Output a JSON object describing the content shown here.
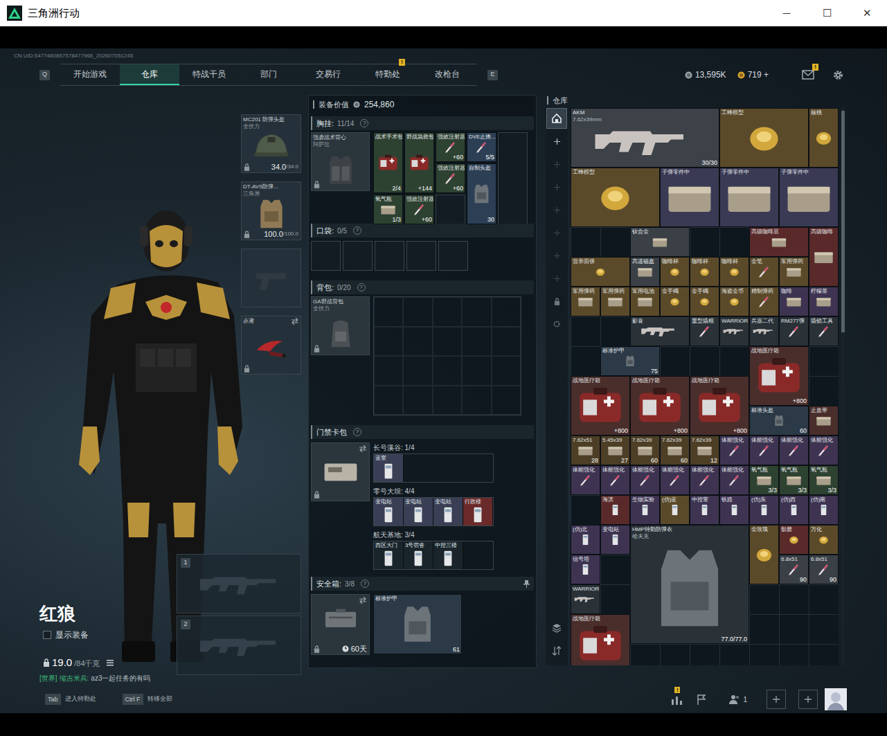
{
  "window": {
    "title": "三角洲行动",
    "controls": [
      "─",
      "☐",
      "✕"
    ]
  },
  "uid": "CN UID:5477460857578477966_202607051245",
  "nav": {
    "prev_key": "Q",
    "next_key": "E",
    "tabs": [
      {
        "label": "开始游戏",
        "selected": false
      },
      {
        "label": "仓库",
        "selected": true
      },
      {
        "label": "特战干员",
        "selected": false
      },
      {
        "label": "部门",
        "selected": false
      },
      {
        "label": "交易行",
        "selected": false
      },
      {
        "label": "特勤处",
        "selected": false,
        "badge": "!"
      },
      {
        "label": "改枪台",
        "selected": false
      }
    ]
  },
  "currency": {
    "coins": "13,595K",
    "bonds": "719 +"
  },
  "mail": {
    "badge": "!"
  },
  "character": {
    "name": "红狼",
    "show_equipment": {
      "label": "显示装备",
      "checked": false
    },
    "weight": "19.0",
    "weight_limit": "/84千克"
  },
  "chat": {
    "channel": "[世界]",
    "sender": "缩吉米兵:",
    "message": "az3一起任务的有吗"
  },
  "equipment_slots": [
    {
      "kind": "helmet",
      "name": "MC201 防弹头盔",
      "sub": "全技力",
      "value": "34.0",
      "max": "/34.0",
      "locked": true
    },
    {
      "kind": "armor",
      "name": "DT-AVS防弹...",
      "sub": "三角洲",
      "value": "100.0",
      "max": "/100.0",
      "locked": true
    },
    {
      "kind": "pistol",
      "locked": false
    },
    {
      "kind": "melee",
      "name": "赤鸢",
      "locked": true
    }
  ],
  "weapon_slots": [
    {
      "number": "1"
    },
    {
      "number": "2"
    }
  ],
  "loadout": {
    "value_label": "装备价值",
    "value": "254,860",
    "chest_rig": {
      "label": "胸挂:",
      "capacity": "11/14",
      "help": "?",
      "item": {
        "name": "强袭战术背心",
        "sub": "阿萨拉",
        "locked": true
      },
      "slots": [
        {
          "name": "战术手术包",
          "count": "2/4",
          "color": "#2e4232"
        },
        {
          "name": "野战急救包",
          "count": "+144",
          "color": "#2e4232"
        },
        {
          "name": "强效注射器",
          "count": "+60",
          "color": "#2e4232"
        },
        {
          "name": "DVE止痛...",
          "count": "5/5",
          "color": "#2c3f55"
        },
        {
          "name": "强效注射器",
          "count": "+60",
          "color": "#2e4232"
        },
        {
          "name": "自制头盔",
          "count": "30",
          "color": "#2c3f55"
        },
        {
          "name": "氧气瓶",
          "count": "1/3",
          "color": "#2e4232"
        },
        {
          "name": "强效注射器",
          "count": "+60",
          "color": "#2e4232"
        }
      ]
    },
    "pockets": {
      "label": "口袋:",
      "capacity": "0/5",
      "help": "?"
    },
    "backpack": {
      "label": "背包:",
      "capacity": "0/20",
      "help": "?",
      "item": {
        "name": "GA野战背包",
        "sub": "全技力",
        "locked": true
      }
    },
    "keycard_case": {
      "label": "门禁卡包",
      "help": "?",
      "locked": true,
      "maps": [
        {
          "label": "长号溪谷: 1/4",
          "cards": [
            {
              "name": "蓝室",
              "color": "#3a3f55"
            }
          ]
        },
        {
          "label": "零号大坝: 4/4",
          "cards": [
            {
              "name": "变电站",
              "color": "#3a3f55"
            },
            {
              "name": "变电站",
              "color": "#3a3f55"
            },
            {
              "name": "变电站",
              "color": "#3a3f55"
            },
            {
              "name": "行政楼",
              "color": "#6a2a2a"
            }
          ]
        },
        {
          "label": "航天基地: 3/4",
          "cards": [
            {
              "name": "西区大门",
              "color": "#1a242b"
            },
            {
              "name": "3号宿舍",
              "color": "#1a242b"
            },
            {
              "name": "中控三楼",
              "color": "#1a242b"
            }
          ]
        }
      ]
    },
    "safe_box": {
      "label": "安全箱:",
      "capacity": "3/8",
      "help": "?",
      "timer": "60天",
      "locked": true,
      "items": [
        {
          "name": "标准护甲",
          "count": "61",
          "color": "#2c3a48"
        }
      ]
    }
  },
  "warehouse": {
    "title": "仓库",
    "side_tabs": [
      {
        "selected": true,
        "disabled": false
      },
      {
        "selected": false,
        "disabled": false
      },
      {
        "selected": false,
        "disabled": true
      },
      {
        "selected": false,
        "disabled": true
      },
      {
        "selected": false,
        "disabled": true
      },
      {
        "selected": false,
        "disabled": true
      },
      {
        "selected": false,
        "disabled": true
      },
      {
        "selected": false,
        "disabled": true
      },
      {
        "selected": false,
        "disabled": false
      },
      {
        "selected": false,
        "disabled": false
      }
    ],
    "items": [
      {
        "name": "AKM",
        "sub": "7.62x39mm",
        "count": "30/30",
        "color": "#3c4248"
      },
      {
        "name": "工蜂模型",
        "color": "#5b4a2a"
      },
      {
        "name": "核桃",
        "color": "#5b4a2a"
      },
      {
        "name": "工蜂模型",
        "color": "#5b4a2a"
      },
      {
        "name": "子弹零件中",
        "color": "#3a3a55"
      },
      {
        "name": "子弹零件中",
        "color": "#3a3a55"
      },
      {
        "name": "子弹零件中",
        "color": "#3a3a55"
      },
      {
        "name": "钛合金",
        "color": "#3a4046"
      },
      {
        "name": "高级咖啡豆",
        "color": "#5a2a2a"
      },
      {
        "name": "高级咖啡",
        "color": "#5a2a2a"
      },
      {
        "name": "营养面饼",
        "color": "#5b4a2a"
      },
      {
        "name": "高速磁盘",
        "color": "#3a4046"
      },
      {
        "name": "咖啡杯",
        "color": "#5b4a2a"
      },
      {
        "name": "咖啡杯",
        "color": "#5b4a2a"
      },
      {
        "name": "咖啡杯",
        "color": "#5b4a2a"
      },
      {
        "name": "金笔",
        "color": "#5b4a2a"
      },
      {
        "name": "军用弹药",
        "color": "#5b4a2a"
      },
      {
        "name": "军用弹药",
        "color": "#5b4a2a"
      },
      {
        "name": "军用弹药",
        "color": "#5b4a2a"
      },
      {
        "name": "军用电池",
        "color": "#5b4a2a"
      },
      {
        "name": "金手镯",
        "color": "#5b4a2a"
      },
      {
        "name": "金手镯",
        "color": "#5b4a2a"
      },
      {
        "name": "海盗金币",
        "color": "#5b4a2a"
      },
      {
        "name": "精制弹药",
        "color": "#5b4a2a"
      },
      {
        "name": "咖啡",
        "color": "#3e3452"
      },
      {
        "name": "柠檬茶",
        "color": "#3e3452"
      },
      {
        "name": "影青",
        "color": "#2a3238"
      },
      {
        "name": "重型撬棍",
        "color": "#2a3238"
      },
      {
        "name": "WARRIOR",
        "color": "#2a3238"
      },
      {
        "name": "兵器二代",
        "color": "#2a3238"
      },
      {
        "name": "RM277弹",
        "color": "#2a3238"
      },
      {
        "name": "撬锁工具",
        "color": "#2a3238"
      },
      {
        "name": "标准护甲",
        "count": "75",
        "color": "#2c3a48"
      },
      {
        "name": "战地医疗箱",
        "count": "+800",
        "color": "#4a2e2c"
      },
      {
        "name": "战地医疗箱",
        "count": "+800",
        "color": "#4a2e2c"
      },
      {
        "name": "战地医疗箱",
        "count": "+800",
        "color": "#4a2e2c"
      },
      {
        "name": "战地医疗箱",
        "count": "+800",
        "color": "#4a2e2c"
      },
      {
        "name": "标准头盔",
        "count": "60",
        "color": "#2c3a48"
      },
      {
        "name": "止血带",
        "color": "#4a2e2c"
      },
      {
        "name": "7.62x51",
        "count": "28",
        "color": "#4d3e26"
      },
      {
        "name": "5.45x39",
        "count": "27",
        "color": "#4d3e26"
      },
      {
        "name": "7.62x39",
        "count": "60",
        "color": "#4d3e26"
      },
      {
        "name": "7.62x39",
        "count": "60",
        "color": "#4d3e26"
      },
      {
        "name": "7.62x39",
        "count": "12",
        "color": "#4d3e26"
      },
      {
        "name": "体能强化",
        "color": "#3e3452"
      },
      {
        "name": "体能强化",
        "color": "#3e3452"
      },
      {
        "name": "体能强化",
        "color": "#3e3452"
      },
      {
        "name": "体能强化",
        "color": "#3e3452"
      },
      {
        "name": "体能强化",
        "color": "#3e3452"
      },
      {
        "name": "体能强化",
        "color": "#3e3452"
      },
      {
        "name": "体能强化",
        "color": "#3e3452"
      },
      {
        "name": "体能强化",
        "color": "#3e3452"
      },
      {
        "name": "体能强化",
        "color": "#3e3452"
      },
      {
        "name": "体能强化",
        "color": "#3e3452"
      },
      {
        "name": "氧气瓶",
        "count": "3/3",
        "color": "#2e4232"
      },
      {
        "name": "氧气瓶",
        "count": "3/3",
        "color": "#2e4232"
      },
      {
        "name": "氧气瓶",
        "count": "3/3",
        "color": "#2e4232"
      },
      {
        "name": "海滨",
        "color": "#5a2a2a"
      },
      {
        "name": "生物实验",
        "color": "#3e3452"
      },
      {
        "name": "(仿)蓝",
        "color": "#5b4a2a"
      },
      {
        "name": "中控室",
        "color": "#3e3452"
      },
      {
        "name": "铁路",
        "color": "#3e3452"
      },
      {
        "name": "(仿)东",
        "color": "#3e3452"
      },
      {
        "name": "(仿)西",
        "color": "#3e3452"
      },
      {
        "name": "(仿)南",
        "color": "#3e3452"
      },
      {
        "name": "(仿)北",
        "color": "#3e3452"
      },
      {
        "name": "变电站",
        "color": "#3e3452"
      },
      {
        "name": "HMP特勤防弹衣",
        "sub": "哈夫克",
        "count": "77.0/77.0",
        "color": "#2a3238"
      },
      {
        "name": "金玫瑰",
        "color": "#5b4a2a"
      },
      {
        "name": "骷髅",
        "color": "#5a2a2a"
      },
      {
        "name": "万化",
        "color": "#5b4a2a"
      },
      {
        "name": "信号塔",
        "color": "#3e3452"
      },
      {
        "name": "6.8x51",
        "count": "90",
        "color": "#3a4046"
      },
      {
        "name": "6.8x51",
        "count": "90",
        "color": "#3a4046"
      },
      {
        "name": "WARRIOR",
        "color": "#2a3238"
      },
      {
        "name": "战地医疗箱",
        "color": "#4a2e2c"
      }
    ]
  },
  "bottom_bar": {
    "hints": [
      {
        "key": "Tab",
        "label": "进入特勤处"
      },
      {
        "key": "Ctrl F",
        "label": "转移全部"
      }
    ],
    "stats_badge": "!",
    "friends": "1"
  }
}
